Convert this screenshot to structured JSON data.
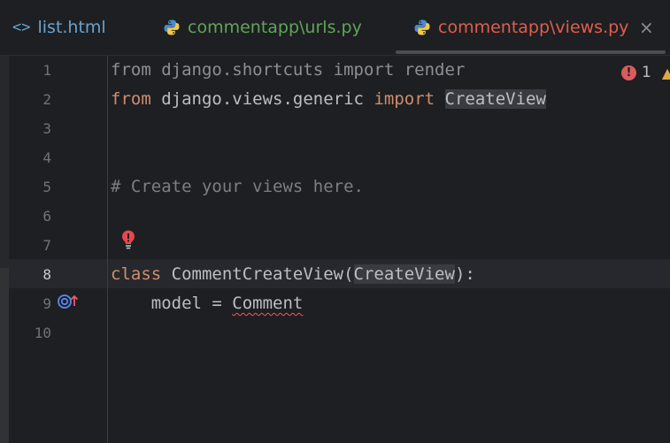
{
  "tabs": [
    {
      "label": "list.html",
      "icon": "html-tag-icon",
      "icon_glyph": "<>"
    },
    {
      "label": "commentapp\\urls.py",
      "icon": "python-icon"
    },
    {
      "label": "commentapp\\views.py",
      "icon": "python-icon",
      "active": true
    }
  ],
  "tab_close_glyph": "×",
  "inspections": {
    "error_count": "1",
    "error_glyph": "!",
    "warning_glyph": "▲"
  },
  "lines": [
    {
      "number": "1",
      "parts": [
        "from django.shortcuts import render"
      ]
    },
    {
      "number": "2",
      "parts": [
        "from",
        " django.views.generic ",
        "import",
        " ",
        "CreateView"
      ]
    },
    {
      "number": "3",
      "parts": []
    },
    {
      "number": "4",
      "parts": []
    },
    {
      "number": "5",
      "parts": [
        "# Create your views here."
      ]
    },
    {
      "number": "6",
      "parts": []
    },
    {
      "number": "7",
      "parts": []
    },
    {
      "number": "8",
      "parts": [
        "class",
        " CommentCreateView(",
        "CreateView",
        "):"
      ]
    },
    {
      "number": "9",
      "parts": [
        "    model = ",
        "Comment"
      ]
    },
    {
      "number": "10",
      "parts": []
    }
  ],
  "colors": {
    "keyword": "#cf8e6d",
    "comment": "#7a7e85",
    "error": "#f75464",
    "active_tab": "#e05d4e",
    "python_tab": "#5fa55a",
    "html_tab": "#6aa3cf"
  }
}
